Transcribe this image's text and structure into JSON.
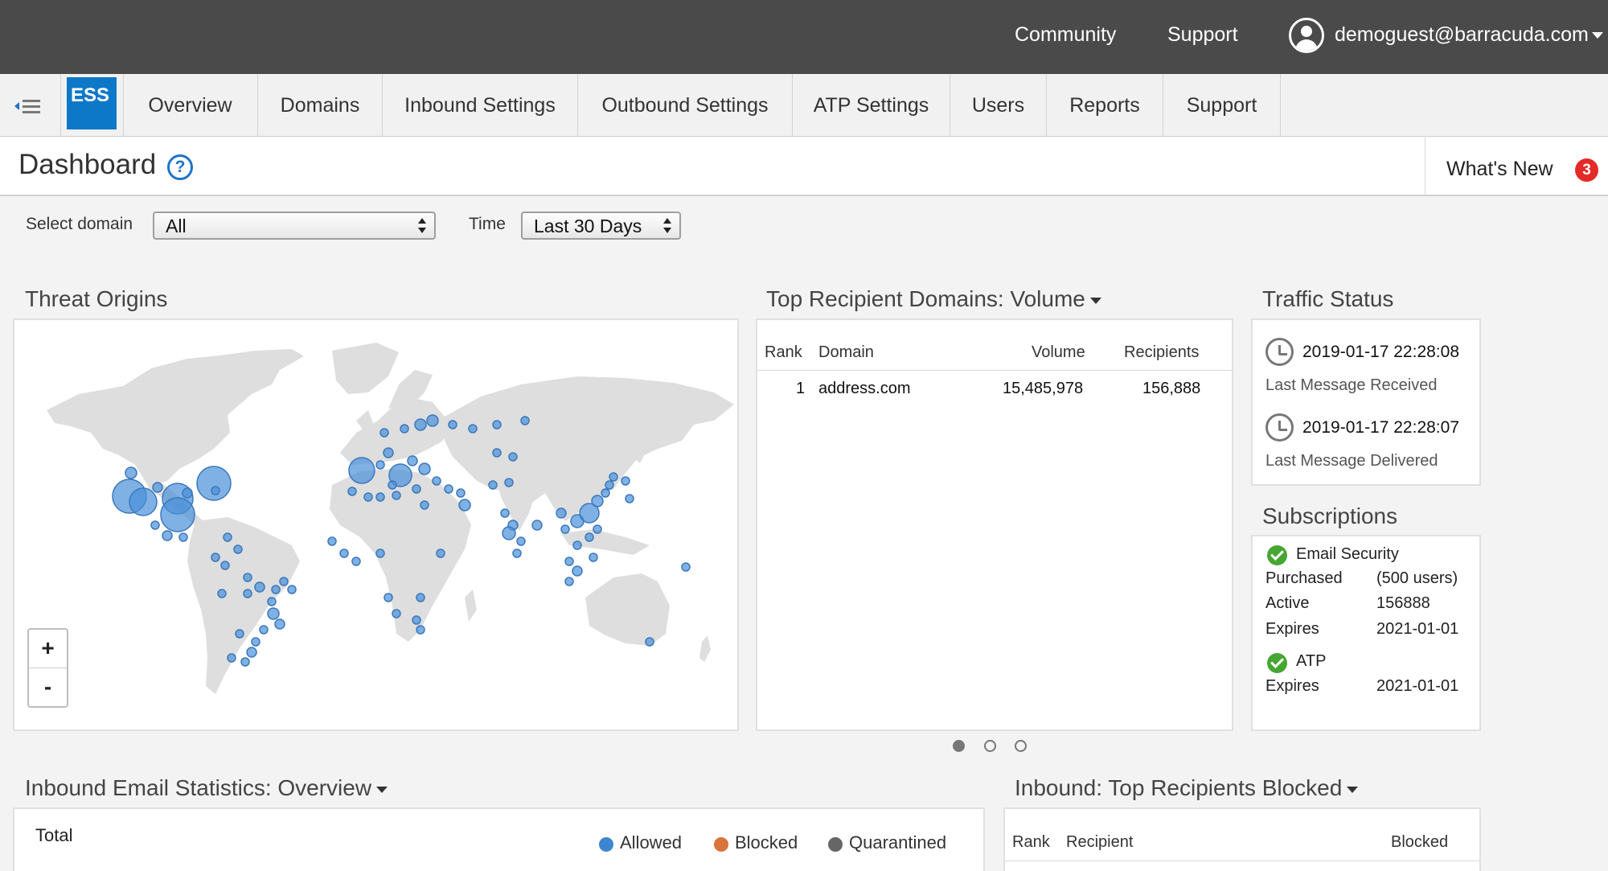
{
  "topbar": {
    "community": "Community",
    "support": "Support",
    "user_email": "demoguest@barracuda.com"
  },
  "nav": {
    "logo": "ESS",
    "tabs": [
      "Overview",
      "Domains",
      "Inbound Settings",
      "Outbound Settings",
      "ATP Settings",
      "Users",
      "Reports",
      "Support"
    ]
  },
  "header": {
    "title": "Dashboard",
    "help": "?",
    "whats_new": "What's New",
    "whats_new_count": "3"
  },
  "filters": {
    "domain_label": "Select domain",
    "domain_value": "All",
    "time_label": "Time",
    "time_value": "Last 30 Days"
  },
  "threat_origins": {
    "title": "Threat Origins",
    "zoom_in": "+",
    "zoom_out": "-",
    "marker_color": "#4a90d9"
  },
  "top_domains": {
    "title": "Top Recipient Domains: Volume",
    "headers": [
      "Rank",
      "Domain",
      "Volume",
      "Recipients"
    ],
    "rows": [
      [
        "1",
        "address.com",
        "15,485,978",
        "156,888"
      ]
    ]
  },
  "traffic_status": {
    "title": "Traffic Status",
    "received_time": "2019-01-17 22:28:08",
    "received_label": "Last Message Received",
    "delivered_time": "2019-01-17 22:28:07",
    "delivered_label": "Last Message Delivered"
  },
  "subscriptions": {
    "title": "Subscriptions",
    "email_security": "Email Security",
    "purchased_label": "Purchased",
    "purchased_value": "(500 users)",
    "active_label": "Active",
    "active_value": "156888",
    "expires_label": "Expires",
    "expires_value": "2021-01-01",
    "atp": "ATP",
    "atp_expires_label": "Expires",
    "atp_expires_value": "2021-01-01"
  },
  "inbound_stats": {
    "title": "Inbound Email Statistics: Overview",
    "total_label": "Total",
    "legend": [
      {
        "label": "Allowed",
        "color": "#3d86cf"
      },
      {
        "label": "Blocked",
        "color": "#d9753a"
      },
      {
        "label": "Quarantined",
        "color": "#666666"
      }
    ]
  },
  "top_blocked": {
    "title": "Inbound: Top Recipients Blocked",
    "headers": [
      "Rank",
      "Recipient",
      "Blocked"
    ]
  }
}
